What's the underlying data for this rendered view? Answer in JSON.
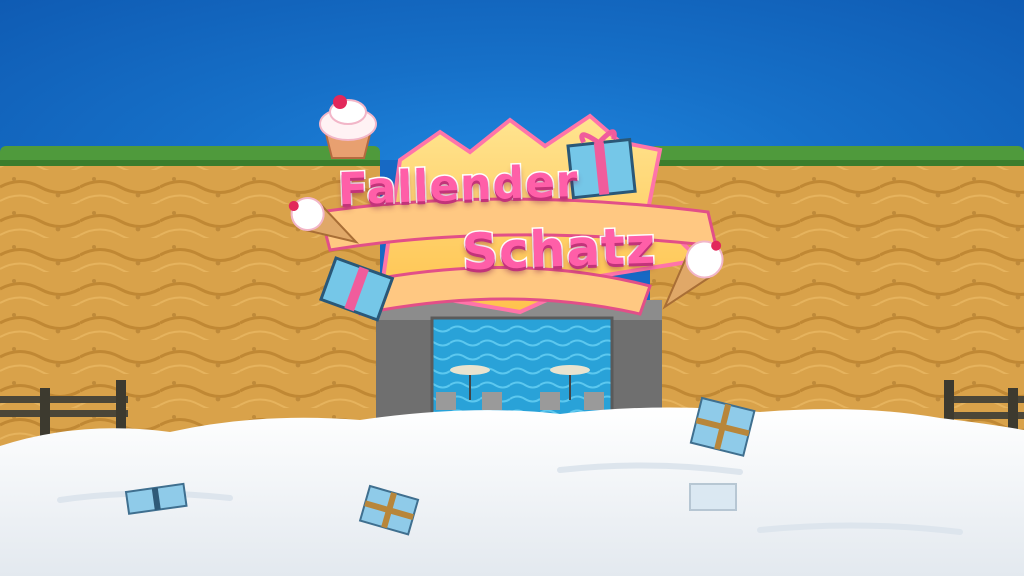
{
  "game": {
    "title_line1": "Fallender",
    "title_line2": "Schatz"
  },
  "colors": {
    "sky": "#1670c8",
    "grass": "#4f9a3c",
    "sand_wall": "#d9a24a",
    "snow": "#f3f5f8",
    "title_pink": "#ff5fa8",
    "banner": "#ffd36a",
    "gift_blue": "#7fc4e8",
    "water": "#2aa3d8"
  },
  "icons": [
    "cupcake-icon",
    "gift-box-icon",
    "ice-cream-cone-icon",
    "gift-box-icon",
    "ice-cream-cone-icon"
  ]
}
